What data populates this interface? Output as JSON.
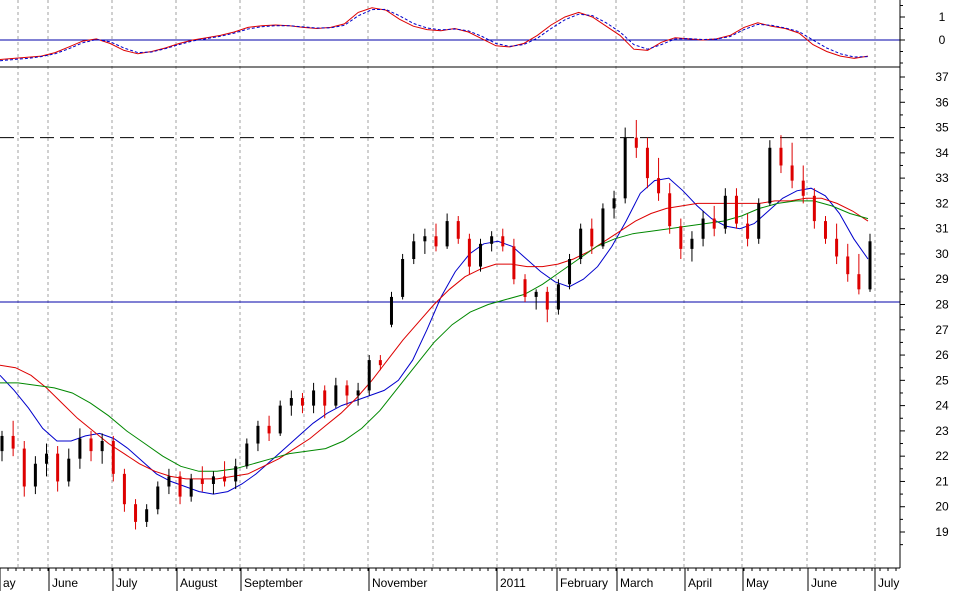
{
  "chart_data": [
    {
      "type": "line",
      "panel": "oscillator",
      "y_ticks": [
        "1",
        "0"
      ],
      "ylim": [
        -1.2,
        1.6
      ],
      "reference_line": 0,
      "series": [
        {
          "color": "#dd0000",
          "style": "solid",
          "values": [
            -0.85,
            -0.8,
            -0.75,
            -0.7,
            -0.55,
            -0.3,
            -0.05,
            0.05,
            -0.15,
            -0.45,
            -0.6,
            -0.5,
            -0.35,
            -0.15,
            0.0,
            0.1,
            0.2,
            0.35,
            0.55,
            0.62,
            0.65,
            0.62,
            0.55,
            0.5,
            0.55,
            0.7,
            1.2,
            1.4,
            1.3,
            0.9,
            0.6,
            0.45,
            0.4,
            0.5,
            0.35,
            0.05,
            -0.25,
            -0.3,
            -0.15,
            0.2,
            0.65,
            1.0,
            1.2,
            1.0,
            0.6,
            0.2,
            -0.4,
            -0.45,
            -0.1,
            0.1,
            0.05,
            0.0,
            0.05,
            0.2,
            0.55,
            0.75,
            0.6,
            0.5,
            0.3,
            -0.2,
            -0.5,
            -0.7,
            -0.8,
            -0.7
          ]
        },
        {
          "color": "#0000cc",
          "style": "dashed",
          "values": [
            -0.9,
            -0.85,
            -0.8,
            -0.72,
            -0.6,
            -0.38,
            -0.12,
            0.02,
            -0.08,
            -0.35,
            -0.55,
            -0.52,
            -0.38,
            -0.2,
            -0.04,
            0.06,
            0.16,
            0.3,
            0.48,
            0.58,
            0.62,
            0.62,
            0.57,
            0.52,
            0.53,
            0.64,
            1.05,
            1.32,
            1.33,
            1.05,
            0.72,
            0.52,
            0.44,
            0.48,
            0.4,
            0.15,
            -0.15,
            -0.28,
            -0.2,
            0.08,
            0.5,
            0.88,
            1.12,
            1.06,
            0.75,
            0.35,
            -0.2,
            -0.4,
            -0.2,
            0.05,
            0.06,
            0.02,
            0.04,
            0.15,
            0.45,
            0.68,
            0.64,
            0.52,
            0.36,
            0.0,
            -0.35,
            -0.6,
            -0.74,
            -0.72
          ]
        }
      ]
    },
    {
      "type": "candlestick",
      "panel": "price",
      "ylim": [
        18,
        37.5
      ],
      "y_ticks": [
        "37",
        "36",
        "35",
        "34",
        "33",
        "32",
        "31",
        "30",
        "29",
        "28",
        "27",
        "26",
        "25",
        "24",
        "23",
        "22",
        "21",
        "20",
        "19"
      ],
      "x_months": [
        "ay",
        "June",
        "July",
        "August",
        "September",
        "November",
        "2011",
        "February",
        "March",
        "April",
        "May",
        "June",
        "July"
      ],
      "horizontal_lines": [
        {
          "value": 34.6,
          "style": "dashed",
          "color": "#000000"
        },
        {
          "value": 28.1,
          "style": "solid",
          "color": "#0000aa"
        }
      ],
      "candles": [
        [
          22.2,
          23.0,
          21.8,
          22.8
        ],
        [
          22.8,
          23.4,
          22.0,
          22.3
        ],
        [
          22.3,
          22.6,
          20.4,
          20.8
        ],
        [
          20.8,
          22.0,
          20.5,
          21.7
        ],
        [
          21.7,
          22.5,
          21.2,
          22.1
        ],
        [
          22.1,
          22.4,
          20.6,
          21.0
        ],
        [
          21.0,
          22.3,
          20.8,
          21.9
        ],
        [
          21.9,
          23.1,
          21.5,
          22.7
        ],
        [
          22.7,
          23.0,
          21.8,
          22.2
        ],
        [
          22.2,
          22.9,
          21.7,
          22.6
        ],
        [
          22.6,
          22.8,
          21.0,
          21.3
        ],
        [
          21.3,
          21.5,
          19.8,
          20.1
        ],
        [
          20.1,
          20.3,
          19.1,
          19.4
        ],
        [
          19.4,
          20.1,
          19.2,
          19.9
        ],
        [
          19.9,
          21.0,
          19.7,
          20.8
        ],
        [
          20.8,
          21.5,
          20.5,
          21.2
        ],
        [
          21.2,
          21.4,
          20.1,
          20.4
        ],
        [
          20.4,
          21.3,
          20.2,
          21.1
        ],
        [
          21.1,
          21.6,
          20.6,
          20.9
        ],
        [
          20.9,
          21.4,
          20.5,
          21.2
        ],
        [
          21.2,
          21.8,
          20.8,
          21.0
        ],
        [
          21.0,
          21.9,
          20.7,
          21.6
        ],
        [
          21.6,
          22.7,
          21.5,
          22.5
        ],
        [
          22.5,
          23.4,
          22.2,
          23.2
        ],
        [
          23.2,
          23.6,
          22.6,
          22.9
        ],
        [
          22.9,
          24.2,
          22.8,
          24.0
        ],
        [
          24.0,
          24.6,
          23.6,
          24.3
        ],
        [
          24.3,
          24.5,
          23.7,
          24.0
        ],
        [
          24.0,
          24.9,
          23.7,
          24.6
        ],
        [
          24.6,
          24.8,
          23.5,
          24.0
        ],
        [
          24.0,
          25.1,
          23.9,
          24.8
        ],
        [
          24.8,
          25.0,
          24.0,
          24.4
        ],
        [
          24.4,
          24.9,
          24.0,
          24.6
        ],
        [
          24.6,
          26.0,
          24.4,
          25.8
        ],
        [
          25.8,
          26.0,
          25.4,
          25.6
        ],
        [
          27.2,
          28.5,
          27.1,
          28.3
        ],
        [
          28.3,
          30.0,
          28.2,
          29.8
        ],
        [
          29.8,
          30.8,
          29.6,
          30.5
        ],
        [
          30.5,
          31.0,
          30.0,
          30.7
        ],
        [
          30.7,
          31.2,
          30.1,
          30.3
        ],
        [
          30.3,
          31.6,
          30.2,
          31.3
        ],
        [
          31.3,
          31.5,
          30.4,
          30.6
        ],
        [
          30.6,
          30.8,
          29.2,
          29.5
        ],
        [
          29.5,
          30.6,
          29.3,
          30.4
        ],
        [
          30.4,
          30.9,
          30.1,
          30.7
        ],
        [
          30.7,
          31.0,
          30.1,
          30.3
        ],
        [
          30.3,
          30.6,
          28.8,
          29.0
        ],
        [
          29.0,
          29.2,
          28.1,
          28.3
        ],
        [
          28.3,
          28.6,
          27.8,
          28.5
        ],
        [
          28.5,
          28.7,
          27.3,
          27.8
        ],
        [
          27.8,
          29.0,
          27.6,
          28.8
        ],
        [
          28.8,
          30.0,
          28.6,
          29.8
        ],
        [
          29.8,
          31.2,
          29.6,
          31.0
        ],
        [
          31.0,
          31.4,
          30.0,
          30.3
        ],
        [
          30.3,
          32.0,
          30.2,
          31.8
        ],
        [
          31.8,
          32.5,
          31.4,
          32.2
        ],
        [
          32.2,
          35.0,
          32.0,
          34.6
        ],
        [
          34.6,
          35.3,
          33.8,
          34.2
        ],
        [
          34.2,
          34.6,
          32.6,
          33.0
        ],
        [
          33.0,
          33.8,
          32.1,
          32.4
        ],
        [
          32.4,
          32.8,
          30.8,
          31.1
        ],
        [
          31.1,
          31.4,
          29.8,
          30.2
        ],
        [
          30.2,
          30.9,
          29.7,
          30.6
        ],
        [
          30.6,
          31.7,
          30.3,
          31.4
        ],
        [
          31.4,
          31.9,
          30.7,
          31.0
        ],
        [
          31.0,
          32.6,
          30.8,
          32.3
        ],
        [
          32.3,
          32.6,
          31.0,
          31.2
        ],
        [
          31.2,
          31.6,
          30.3,
          30.6
        ],
        [
          30.6,
          32.2,
          30.4,
          32.0
        ],
        [
          32.0,
          34.5,
          31.9,
          34.2
        ],
        [
          34.2,
          34.7,
          33.2,
          33.5
        ],
        [
          33.5,
          34.4,
          32.6,
          32.9
        ],
        [
          32.9,
          33.5,
          32.0,
          32.3
        ],
        [
          32.3,
          32.6,
          31.0,
          31.3
        ],
        [
          31.3,
          31.5,
          30.4,
          30.6
        ],
        [
          30.6,
          31.2,
          29.6,
          29.9
        ],
        [
          29.9,
          30.4,
          28.9,
          29.2
        ],
        [
          29.2,
          30.0,
          28.4,
          28.6
        ],
        [
          28.6,
          30.8,
          28.5,
          30.5
        ]
      ],
      "series": [
        {
          "color": "#0000cc",
          "values": [
            25.2,
            24.6,
            23.9,
            23.1,
            22.6,
            22.6,
            22.8,
            22.9,
            22.7,
            22.3,
            21.8,
            21.3,
            21.0,
            20.8,
            20.6,
            20.5,
            20.6,
            20.9,
            21.3,
            21.8,
            22.3,
            22.8,
            23.3,
            23.7,
            24.0,
            24.2,
            24.4,
            24.6,
            25.0,
            25.8,
            27.0,
            28.3,
            29.3,
            30.0,
            30.4,
            30.5,
            30.3,
            29.8,
            29.3,
            28.9,
            28.7,
            29.0,
            29.5,
            30.3,
            31.3,
            32.4,
            32.9,
            33.0,
            32.5,
            31.9,
            31.4,
            31.1,
            31.0,
            31.2,
            31.7,
            32.2,
            32.5,
            32.6,
            32.3,
            31.6,
            30.6,
            29.8
          ]
        },
        {
          "color": "#dd0000",
          "values": [
            25.6,
            25.5,
            25.2,
            24.7,
            24.1,
            23.5,
            23.0,
            22.5,
            22.1,
            21.7,
            21.4,
            21.2,
            21.1,
            21.1,
            21.1,
            21.2,
            21.3,
            21.6,
            21.9,
            22.3,
            22.7,
            23.2,
            23.7,
            24.3,
            25.0,
            25.8,
            26.6,
            27.3,
            28.0,
            28.6,
            29.1,
            29.4,
            29.6,
            29.6,
            29.5,
            29.5,
            29.6,
            29.8,
            30.1,
            30.5,
            30.9,
            31.3,
            31.6,
            31.8,
            31.9,
            32.0,
            32.0,
            32.0,
            32.0,
            32.0,
            32.1,
            32.1,
            32.2,
            32.2,
            32.0,
            31.7,
            31.3
          ]
        },
        {
          "color": "#008800",
          "values": [
            24.9,
            24.9,
            24.8,
            24.7,
            24.5,
            24.1,
            23.6,
            23.0,
            22.5,
            22.0,
            21.6,
            21.4,
            21.4,
            21.5,
            21.7,
            21.9,
            22.1,
            22.2,
            22.3,
            22.6,
            23.1,
            23.8,
            24.7,
            25.6,
            26.5,
            27.2,
            27.7,
            28.0,
            28.2,
            28.4,
            28.8,
            29.3,
            29.8,
            30.3,
            30.6,
            30.8,
            30.9,
            31.0,
            31.1,
            31.2,
            31.3,
            31.5,
            31.8,
            32.0,
            32.1,
            32.1,
            31.9,
            31.6,
            31.4
          ]
        }
      ]
    }
  ]
}
